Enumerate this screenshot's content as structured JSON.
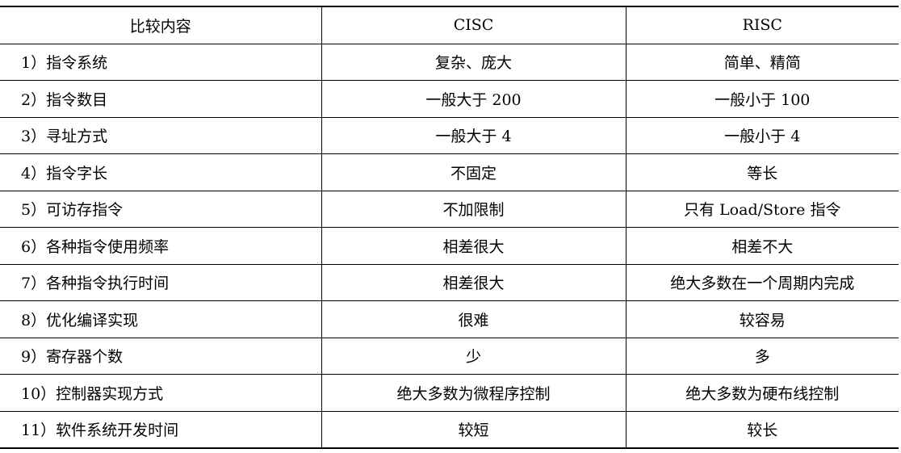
{
  "table": {
    "headers": [
      "比较内容",
      "CISC",
      "RISC"
    ],
    "rows": [
      [
        "1）指令系统",
        "复杂、庞大",
        "简单、精简"
      ],
      [
        "2）指令数目",
        "一般大于 200",
        "一般小于 100"
      ],
      [
        "3）寻址方式",
        "一般大于 4",
        "一般小于 4"
      ],
      [
        "4）指令字长",
        "不固定",
        "等长"
      ],
      [
        "5）可访存指令",
        "不加限制",
        "只有 Load/Store 指令"
      ],
      [
        "6）各种指令使用频率",
        "相差很大",
        "相差不大"
      ],
      [
        "7）各种指令执行时间",
        "相差很大",
        "绝大多数在一个周期内完成"
      ],
      [
        "8）优化编译实现",
        "很难",
        "较容易"
      ],
      [
        "9）寄存器个数",
        "少",
        "多"
      ],
      [
        "10）控制器实现方式",
        "绝大多数为微程序控制",
        "绝大多数为硬布线控制"
      ],
      [
        "11）软件系统开发时间",
        "较短",
        "较长"
      ]
    ]
  }
}
